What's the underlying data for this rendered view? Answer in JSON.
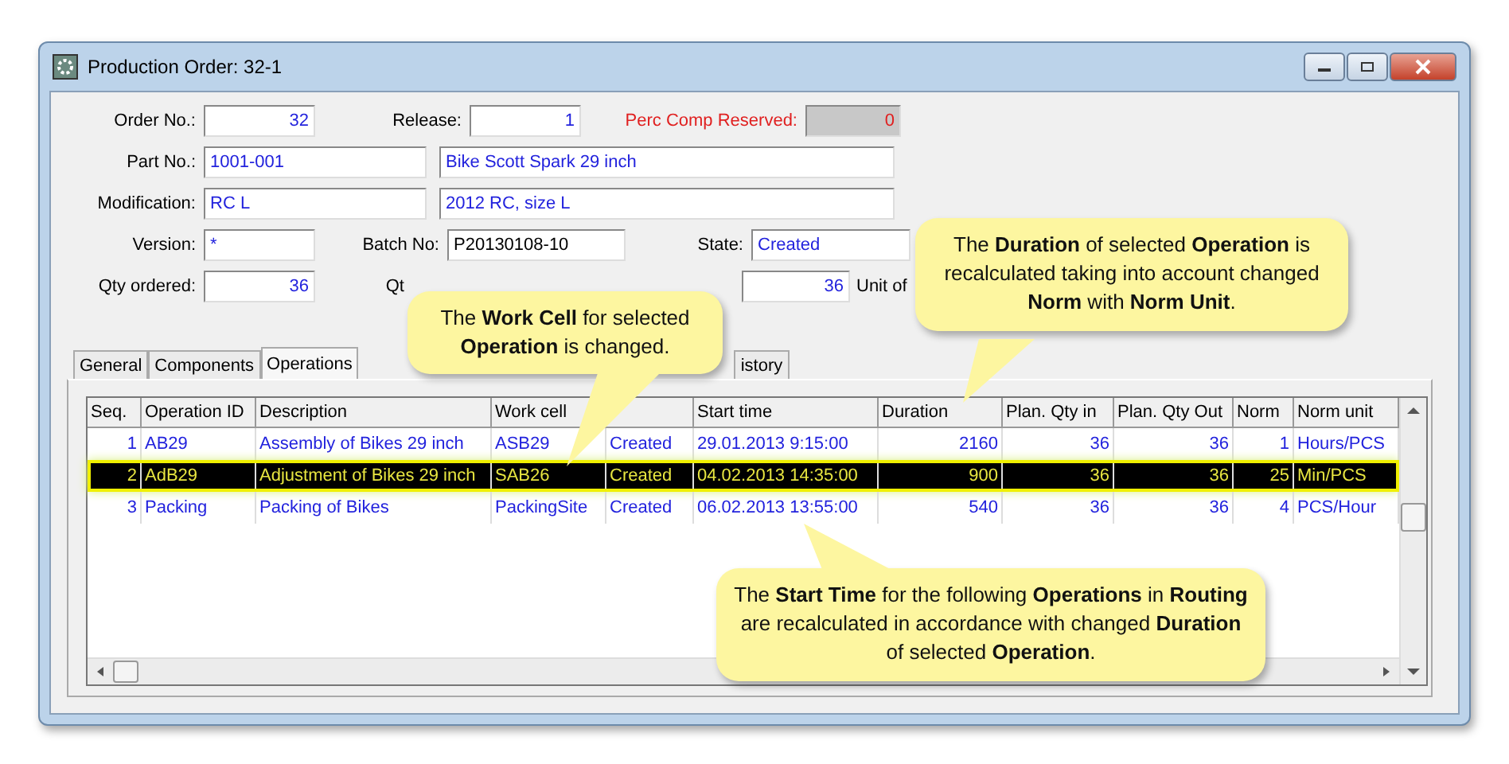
{
  "window": {
    "title": "Production Order: 32-1"
  },
  "form": {
    "order_no": {
      "label": "Order No.:",
      "value": "32"
    },
    "release": {
      "label": "Release:",
      "value": "1"
    },
    "perc_comp": {
      "label": "Perc Comp Reserved:",
      "value": "0",
      "disabled": true
    },
    "part_no": {
      "label": "Part No.:",
      "value": "1001-001",
      "description": "Bike Scott Spark 29 inch"
    },
    "modification": {
      "label": "Modification:",
      "value": "RC L",
      "description": "2012 RC, size L"
    },
    "version": {
      "label": "Version:",
      "value": "*"
    },
    "batch_no": {
      "label": "Batch No:",
      "value": "P20130108-10"
    },
    "state": {
      "label": "State:",
      "value": "Created"
    },
    "qty_ordered": {
      "label": "Qty ordered:",
      "value": "36"
    },
    "qty_ready": {
      "label": "Qt"
    },
    "qty_estimated": {
      "value": "36"
    },
    "unit": {
      "label": "Unit of"
    }
  },
  "tabs": [
    {
      "label": "General",
      "selected": false
    },
    {
      "label": "Components",
      "selected": false
    },
    {
      "label": "Operations",
      "selected": true
    },
    {
      "label": "istory",
      "selected": false
    }
  ],
  "table": {
    "columns": [
      {
        "label": "Seq."
      },
      {
        "label": "Operation ID"
      },
      {
        "label": "Description"
      },
      {
        "label": "Work cell"
      },
      {},
      {
        "label": "Start time"
      },
      {
        "label": "Duration"
      },
      {
        "label": "Plan. Qty in"
      },
      {
        "label": "Plan. Qty Out"
      },
      {
        "label": "Norm"
      },
      {
        "label": "Norm unit"
      }
    ],
    "rows": [
      {
        "selected": false,
        "cells": [
          "1",
          "AB29",
          "Assembly of Bikes 29 inch",
          "ASB29",
          "Created",
          "29.01.2013 9:15:00",
          "2160",
          "36",
          "36",
          "1",
          "Hours/PCS"
        ]
      },
      {
        "selected": true,
        "cells": [
          "2",
          "AdB29",
          "Adjustment of Bikes 29 inch",
          "SAB26",
          "Created",
          "04.02.2013 14:35:00",
          "900",
          "36",
          "36",
          "25",
          "Min/PCS"
        ]
      },
      {
        "selected": false,
        "cells": [
          "3",
          "Packing",
          "Packing of Bikes",
          "PackingSite",
          "Created",
          "06.02.2013 13:55:00",
          "540",
          "36",
          "36",
          "4",
          "PCS/Hour"
        ]
      }
    ]
  },
  "callouts": [
    {
      "text": "The **Work Cell** for selected **Operation** is changed."
    },
    {
      "text": "The **Duration** of selected **Operation** is recalculated taking into account changed **Norm** with **Norm Unit**."
    },
    {
      "text": "The **Start Time** for the following **Operations** in **Routing** are recalculated in accordance with changed **Duration** of selected **Operation**."
    }
  ]
}
